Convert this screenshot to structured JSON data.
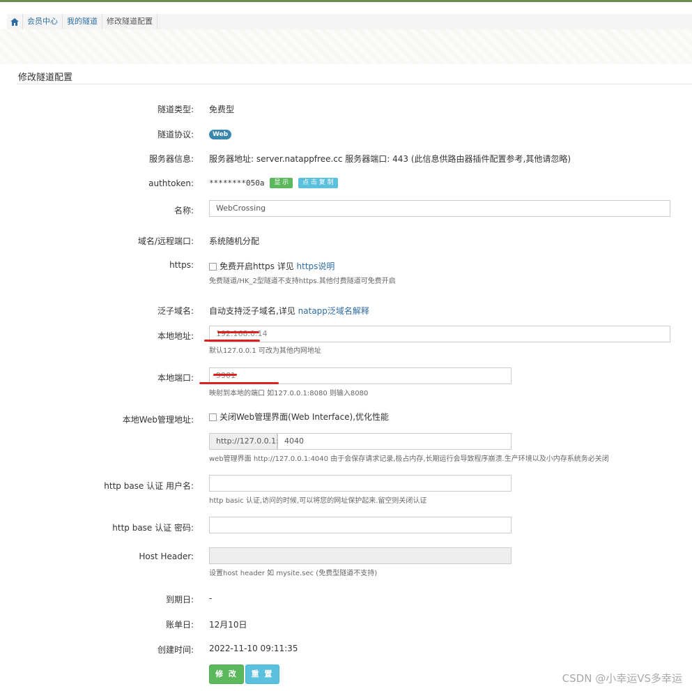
{
  "breadcrumb": {
    "items": [
      "会员中心",
      "我的隧道",
      "修改隧道配置"
    ]
  },
  "panel": {
    "title": "修改隧道配置"
  },
  "fields": {
    "type": {
      "label": "隧道类型:",
      "value": "免费型"
    },
    "protocol": {
      "label": "隧道协议:",
      "badge": "Web"
    },
    "server": {
      "label": "服务器信息:",
      "value": "服务器地址: server.natappfree.cc 服务器端口: 443 (此信息供路由器插件配置参考,其他请忽略)"
    },
    "authtoken": {
      "label": "authtoken:",
      "value": "********050a",
      "show_btn": "显 示",
      "copy_btn": "点 击 复 制"
    },
    "name": {
      "label": "名称:",
      "value": "WebCrossing"
    },
    "domain": {
      "label": "域名/远程端口:",
      "value": "系统随机分配"
    },
    "https": {
      "label": "https:",
      "checkbox_text": "免费开启https 详见",
      "link": "https说明",
      "help": "免费隧道/HK_2型隧道不支持https.其他付费隧道可免费开启"
    },
    "wildcard": {
      "label": "泛子域名:",
      "text": "自动支持泛子域名,详见",
      "link": "natapp泛域名解释"
    },
    "local_addr": {
      "label": "本地地址:",
      "value": "192.168.0.14",
      "help": "默认127.0.0.1 可改为其他内网地址"
    },
    "local_port": {
      "label": "本地端口:",
      "value": "9901",
      "help": "映射到本地的端口 如127.0.0.1:8080 则输入8080"
    },
    "web_admin": {
      "label": "本地Web管理地址:",
      "checkbox_text": "关闭Web管理界面(Web Interface),优化性能",
      "addon": "http://127.0.0.1:",
      "port": "4040",
      "help": "web管理界面 http://127.0.0.1:4040 由于会保存请求记录,极占内存,长期运行会导致程序崩溃.生产环境以及小内存系统务必关闭"
    },
    "auth_user": {
      "label": "http base 认证 用户名:",
      "value": "",
      "help": "http basic 认证,访问的时候,可以将您的网址保护起来.留空则关闭认证"
    },
    "auth_pass": {
      "label": "http base 认证 密码:",
      "value": ""
    },
    "host_header": {
      "label": "Host Header:",
      "value": "",
      "help": "设置host header 如 mysite.sec (免费型隧道不支持)"
    },
    "expire": {
      "label": "到期日:",
      "value": "-"
    },
    "billing": {
      "label": "账单日:",
      "value": "12月10日"
    },
    "created": {
      "label": "创建时间:",
      "value": "2022-11-10 09:11:35"
    }
  },
  "buttons": {
    "save": "修 改",
    "reset": "重 置"
  },
  "watermark": "CSDN @小幸运VS多幸运",
  "colors": {
    "accent": "#5cb85c",
    "info": "#5bc0de",
    "link": "#2e6da4",
    "redact": "#d9221f"
  }
}
